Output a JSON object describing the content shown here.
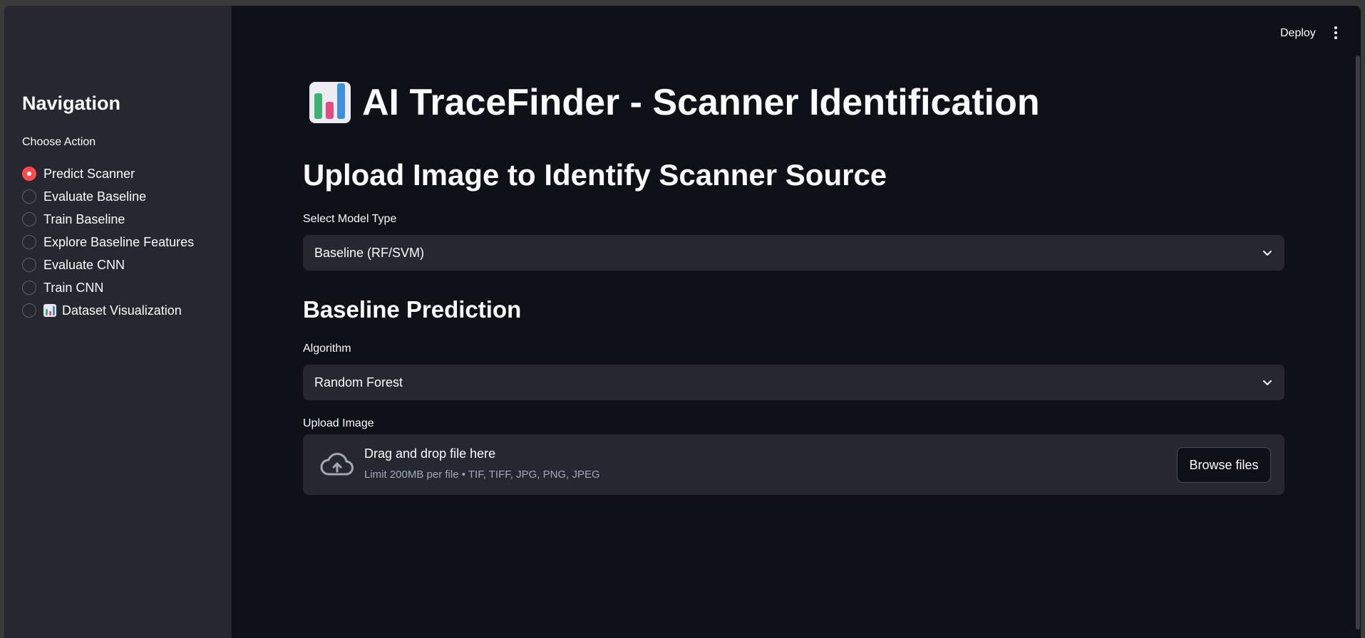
{
  "topbar": {
    "deploy_label": "Deploy",
    "menu_icon": "kebab-menu-icon"
  },
  "sidebar": {
    "title": "Navigation",
    "radio_label": "Choose Action",
    "selected": "Predict Scanner",
    "items": [
      {
        "label": "Predict Scanner",
        "checked": true
      },
      {
        "label": "Evaluate Baseline",
        "checked": false
      },
      {
        "label": "Train Baseline",
        "checked": false
      },
      {
        "label": "Explore Baseline Features",
        "checked": false
      },
      {
        "label": "Evaluate CNN",
        "checked": false
      },
      {
        "label": "Train CNN",
        "checked": false
      },
      {
        "label": "Dataset Visualization",
        "checked": false,
        "icon": "bar-chart-icon"
      }
    ]
  },
  "main": {
    "title": "AI TraceFinder - Scanner Identification",
    "title_icon": "bar-chart-icon",
    "subtitle": "Upload Image to Identify Scanner Source",
    "model_type": {
      "label": "Select Model Type",
      "value": "Baseline (RF/SVM)"
    },
    "section_title": "Baseline Prediction",
    "algorithm": {
      "label": "Algorithm",
      "value": "Random Forest"
    },
    "upload": {
      "label": "Upload Image",
      "drop_text": "Drag and drop file here",
      "limit_text": "Limit 200MB per file • TIF, TIFF, JPG, PNG, JPEG",
      "button_label": "Browse files",
      "icon": "cloud-upload-icon"
    }
  },
  "colors": {
    "background": "#0e1117",
    "sidebar": "#262730",
    "accent": "#ff4b4b",
    "text": "#fafafa",
    "muted": "#a3a8b8"
  }
}
